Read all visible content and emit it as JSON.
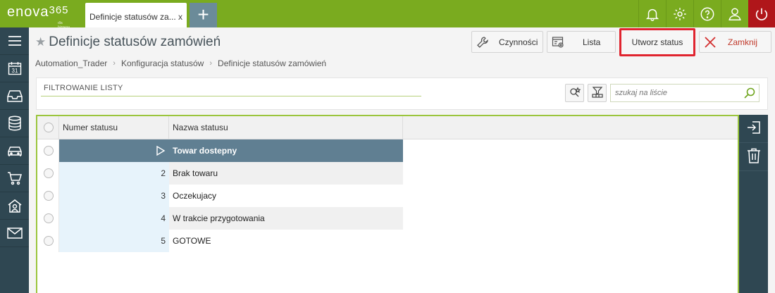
{
  "app": {
    "logo_main": "enova",
    "logo_num": "365",
    "logo_sub": "dla biznesu"
  },
  "tabs": [
    {
      "label": "Definicje statusów za...",
      "close": "x"
    }
  ],
  "topbar_icons": [
    "bell-icon",
    "gear-icon",
    "help-icon",
    "user-icon",
    "power-icon"
  ],
  "sidebar_icons": [
    "menu-icon",
    "calendar-icon",
    "inbox-icon",
    "database-icon",
    "car-icon",
    "cart-icon",
    "home-person-icon",
    "mail-icon"
  ],
  "calendar_day": "31",
  "page": {
    "star": "★",
    "title": "Definicje statusów zamówień"
  },
  "actions": {
    "czynnosci": "Czynności",
    "lista": "Lista",
    "utworz": "Utworz status",
    "zamknij": "Zamknij"
  },
  "breadcrumb": [
    "Automation_Trader",
    "Konfiguracja statusów",
    "Definicje statusów zamówień"
  ],
  "breadcrumb_sep": "›",
  "filter": {
    "label": "FILTROWANIE LISTY",
    "search_placeholder": "szukaj na liście"
  },
  "grid": {
    "columns": [
      "Numer statusu",
      "Nazwa statusu"
    ],
    "rows": [
      {
        "num": "",
        "name": "Towar dostepny",
        "selected": true
      },
      {
        "num": "2",
        "name": "Brak towaru"
      },
      {
        "num": "3",
        "name": "Oczekujacy"
      },
      {
        "num": "4",
        "name": "W trakcie przygotowania"
      },
      {
        "num": "5",
        "name": "GOTOWE"
      }
    ]
  },
  "colors": {
    "topbar": "#7aab1f",
    "sidebar": "#2f4752",
    "selected_row": "#607f92",
    "highlight_border": "#e0242f",
    "power": "#b0161a"
  }
}
